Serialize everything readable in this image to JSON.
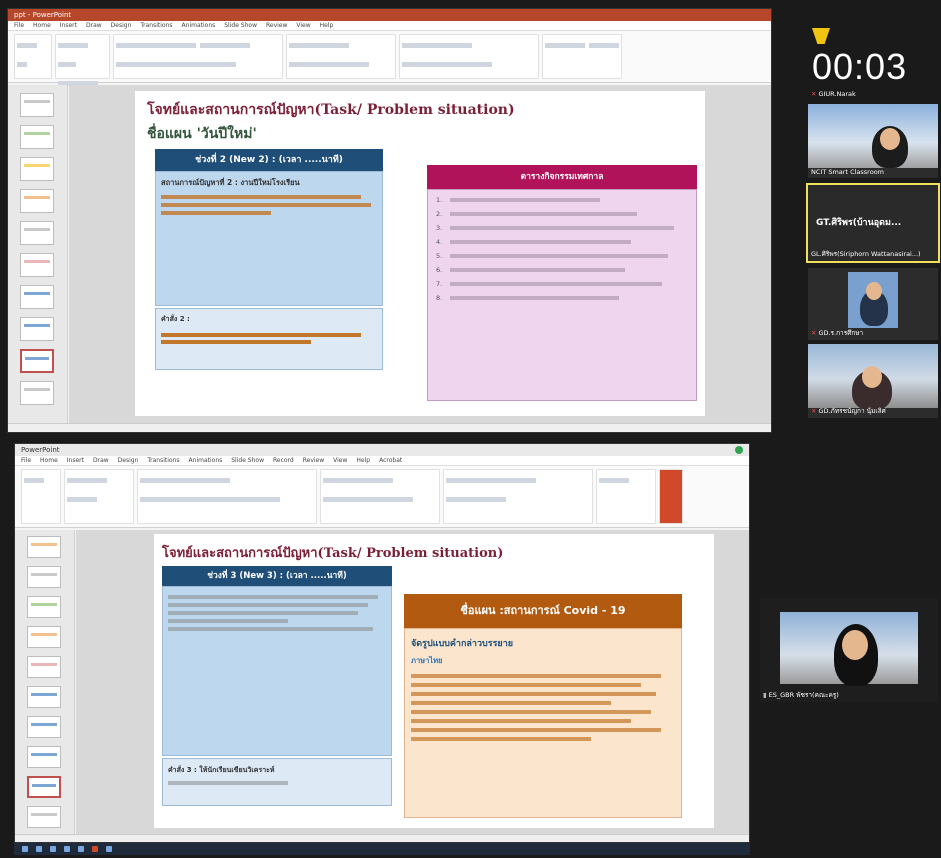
{
  "meeting": {
    "timer": "00:03",
    "participants": [
      {
        "name": "GIUR.Narak"
      },
      {
        "name": "NCIT Smart Classroom"
      },
      {
        "name": "GT.ศิริพร(บ้านอุดม...",
        "subname": "GL.ศิริพร(Siriphorn Wattanasirai...)"
      },
      {
        "name": "GD.ร.การศึกษา"
      },
      {
        "name": "GD.ภัทรชนัญกา นุ้มเลิศ"
      },
      {
        "name": "ES_GBR พัชรา(คณะครู)"
      }
    ]
  },
  "top_screen": {
    "app_title": "ppt - PowerPoint",
    "menu": [
      "File",
      "Home",
      "Insert",
      "Draw",
      "Design",
      "Transitions",
      "Animations",
      "Slide Show",
      "Review",
      "View",
      "Help"
    ],
    "slide": {
      "title": "โจทย์และสถานการณ์ปัญหา(Task/ Problem situation)",
      "subtitle": "ชื่อแผน  'วันปีใหม่'",
      "box_header": "ช่วงที่ 2 (New 2) : (เวลา .....นาที)",
      "box_text": "สถานการณ์ปัญหาที่ 2 : งานปีใหม่โรงเรียน",
      "note_label": "คำสั่ง 2 :",
      "pink_header": "ตารางกิจกรรมเทศกาล",
      "pink_items": [
        "1.",
        "2.",
        "3.",
        "4.",
        "5.",
        "6.",
        "7.",
        "8."
      ]
    }
  },
  "bottom_screen": {
    "app_title": "PowerPoint",
    "menu": [
      "File",
      "Home",
      "Insert",
      "Draw",
      "Design",
      "Transitions",
      "Animations",
      "Slide Show",
      "Record",
      "Review",
      "View",
      "Help",
      "Acrobat"
    ],
    "slide": {
      "title": "โจทย์และสถานการณ์ปัญหา(Task/ Problem situation)",
      "box_header": "ช่วงที่ 3 (New 3) : (เวลา .....นาที)",
      "note_text": "คำสั่ง 3 : ให้นักเรียนเขียนวิเคราะห์",
      "brown_header": "ชื่อแผน :สถานการณ์ Covid - 19",
      "cream_title": "จัดรูปแบบคำกล่าวบรรยาย",
      "cream_sub": "ภาษาไทย"
    }
  },
  "colors": {
    "accent_red": "#b7472a",
    "title_maroon": "#7b1f36",
    "navy": "#1f4e79",
    "magenta": "#b0135a",
    "brown": "#b25a10",
    "highlight": "#f1e05a"
  }
}
